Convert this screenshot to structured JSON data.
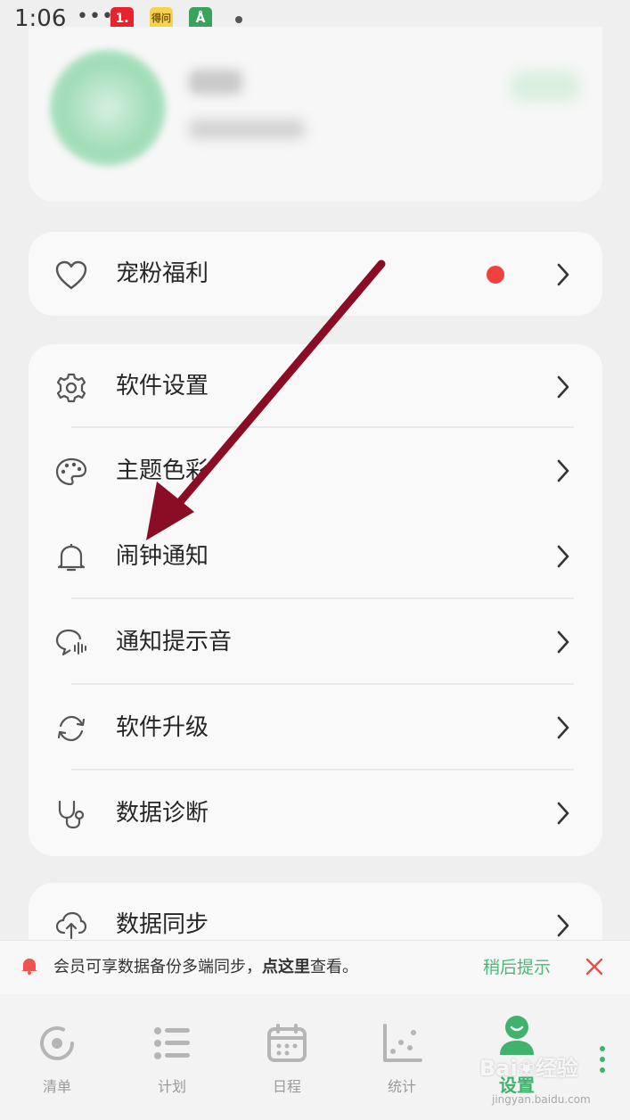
{
  "status_bar": {
    "time": "1:06",
    "dots": "•••",
    "app_icons": [
      {
        "name": "app-1-icon",
        "glyph": "1.",
        "bg": "#e7242d",
        "color": "#ffffff"
      },
      {
        "name": "app-news-icon",
        "glyph": "得问",
        "bg": "#f6d34a",
        "color": "#7a5a00"
      },
      {
        "name": "app-tower-icon",
        "glyph": "Å",
        "bg": "#3aa35a",
        "color": "#ffffff"
      }
    ]
  },
  "welfare": {
    "label": "宠粉福利",
    "has_red_dot": true
  },
  "settings_menu": [
    {
      "label": "软件设置",
      "icon": "gear-icon"
    },
    {
      "label": "主题色彩",
      "icon": "palette-icon"
    },
    {
      "label": "闹钟通知",
      "icon": "bell-icon"
    },
    {
      "label": "通知提示音",
      "icon": "sound-bubble-icon"
    },
    {
      "label": "软件升级",
      "icon": "refresh-icon"
    },
    {
      "label": "数据诊断",
      "icon": "stethoscope-icon"
    }
  ],
  "sync_menu": [
    {
      "label": "数据同步",
      "icon": "cloud-upload-icon"
    }
  ],
  "notice": {
    "text_before": "会员可享数据备份多端同步，",
    "text_bold": "点这里",
    "text_after": "查看。",
    "later_label": "稍后提示"
  },
  "tabbar": {
    "tabs": [
      {
        "label": "清单",
        "icon": "circle-target-icon",
        "active": false
      },
      {
        "label": "计划",
        "icon": "list-icon",
        "active": false
      },
      {
        "label": "日程",
        "icon": "calendar-icon",
        "active": false
      },
      {
        "label": "统计",
        "icon": "scatter-chart-icon",
        "active": false
      },
      {
        "label": "设置",
        "icon": "user-icon",
        "active": true
      }
    ]
  },
  "watermark": {
    "text": "Bai❀经验",
    "sub": "jingyan.baidu.com"
  },
  "colors": {
    "accent": "#3fb36b",
    "arrow": "#8b0d25",
    "red_dot": "#f0413d",
    "close": "#e0504a"
  }
}
